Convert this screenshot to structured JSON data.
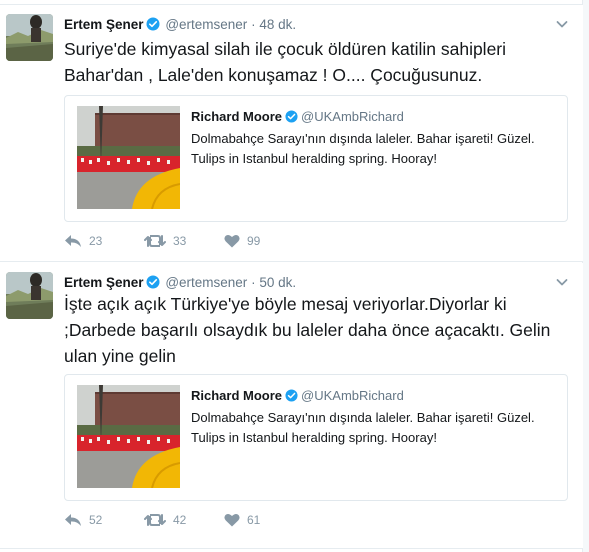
{
  "tweets": [
    {
      "author_name": "Ertem Şener",
      "handle": "@ertemsener",
      "separator": "·",
      "time": "48 dk.",
      "text": "Suriye'de kimyasal silah ile çocuk öldüren katilin sahipleri Bahar'dan , Lale'den konuşamaz ! O.... Çocuğusunuz.",
      "quote": {
        "author_name": "Richard Moore",
        "handle": "@UKAmbRichard",
        "text": "Dolmabahçe Sarayı'nın dışında laleler.   Bahar işareti! Güzel. Tulips in Istanbul heralding spring.  Hooray!"
      },
      "replies": "23",
      "retweets": "33",
      "likes": "99"
    },
    {
      "author_name": "Ertem Şener",
      "handle": "@ertemsener",
      "separator": "·",
      "time": "50 dk.",
      "text": "İşte açık açık Türkiye'ye böyle mesaj veriyorlar.Diyorlar ki ;Darbede başarılı olsaydık bu laleler daha önce açacaktı. Gelin ulan yine gelin",
      "quote": {
        "author_name": "Richard Moore",
        "handle": "@UKAmbRichard",
        "text": "Dolmabahçe Sarayı'nın dışında laleler.   Bahar işareti! Güzel. Tulips in Istanbul heralding spring.  Hooray!"
      },
      "replies": "52",
      "retweets": "42",
      "likes": "61"
    }
  ],
  "icons": {
    "verified": "verified-badge-icon",
    "caret": "chevron-down-icon",
    "reply": "reply-icon",
    "retweet": "retweet-icon",
    "like": "heart-icon"
  },
  "colors": {
    "verified_blue": "#1da1f2",
    "muted_gray": "#657786",
    "action_gray": "#8899a6",
    "tulip_red": "#d8242c",
    "taxi_yellow": "#f2b705"
  }
}
